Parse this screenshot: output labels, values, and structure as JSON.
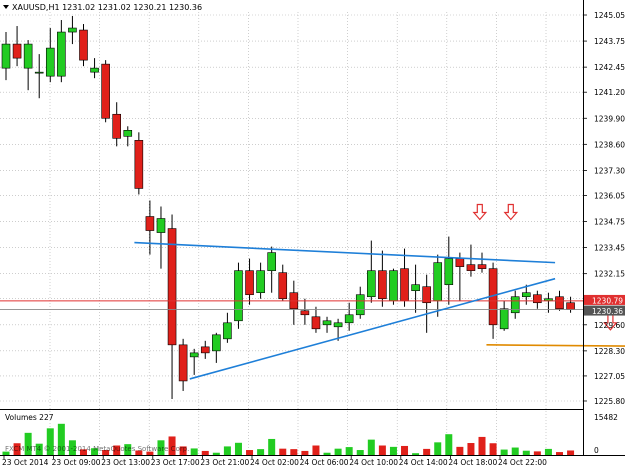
{
  "header": {
    "symbol_line": "XAUUSD,H1  1231.02 1231.02 1230.21 1230.36"
  },
  "volume_panel": {
    "title": "Volumes 227",
    "max_label": "15482",
    "min_label": "0"
  },
  "watermark": "FXCM MT4 © 2001-2014 MetaQuotes Software Corp.",
  "price_tags": {
    "ask": "1230.79",
    "bid": "1230.36"
  },
  "colors": {
    "bull": "#22cc22",
    "bear": "#e0201a",
    "trendline": "#1e7fd8",
    "support": "#e08a00",
    "ask_line": "#e03030",
    "bid_line": "#888888",
    "arrow": "#e03030"
  },
  "chart_data": {
    "type": "candlestick",
    "title": "XAUUSD,H1",
    "ylim": [
      1225.6,
      1245.2
    ],
    "y_ticks": [
      "1245.05",
      "1243.75",
      "1242.45",
      "1241.20",
      "1239.90",
      "1238.60",
      "1237.30",
      "1236.05",
      "1234.75",
      "1233.45",
      "1232.15",
      "1230.90",
      "1229.60",
      "1228.30",
      "1227.05",
      "1225.80"
    ],
    "x_ticks": [
      "23 Oct 2014",
      "23 Oct 09:00",
      "23 Oct 13:00",
      "23 Oct 17:00",
      "23 Oct 21:00",
      "24 Oct 02:00",
      "24 Oct 06:00",
      "24 Oct 10:00",
      "24 Oct 14:00",
      "24 Oct 18:00",
      "24 Oct 22:00"
    ],
    "candles": [
      {
        "o": 1242.4,
        "h": 1244.2,
        "l": 1241.8,
        "c": 1243.6
      },
      {
        "o": 1243.6,
        "h": 1244.5,
        "l": 1242.5,
        "c": 1242.9
      },
      {
        "o": 1242.4,
        "h": 1243.8,
        "l": 1241.3,
        "c": 1243.6
      },
      {
        "o": 1242.2,
        "h": 1243.1,
        "l": 1240.9,
        "c": 1242.2
      },
      {
        "o": 1242.0,
        "h": 1244.4,
        "l": 1241.7,
        "c": 1243.4
      },
      {
        "o": 1242.0,
        "h": 1244.8,
        "l": 1241.7,
        "c": 1244.2
      },
      {
        "o": 1244.2,
        "h": 1245.0,
        "l": 1243.6,
        "c": 1244.4
      },
      {
        "o": 1244.3,
        "h": 1244.6,
        "l": 1242.5,
        "c": 1242.8
      },
      {
        "o": 1242.2,
        "h": 1242.9,
        "l": 1241.9,
        "c": 1242.4
      },
      {
        "o": 1242.6,
        "h": 1242.8,
        "l": 1239.7,
        "c": 1239.9
      },
      {
        "o": 1240.1,
        "h": 1240.7,
        "l": 1238.5,
        "c": 1238.9
      },
      {
        "o": 1239.0,
        "h": 1239.5,
        "l": 1238.5,
        "c": 1239.3
      },
      {
        "o": 1238.8,
        "h": 1239.2,
        "l": 1236.1,
        "c": 1236.4
      },
      {
        "o": 1235.0,
        "h": 1235.8,
        "l": 1233.1,
        "c": 1234.3
      },
      {
        "o": 1234.2,
        "h": 1235.5,
        "l": 1232.4,
        "c": 1234.9
      },
      {
        "o": 1234.4,
        "h": 1235.1,
        "l": 1225.9,
        "c": 1228.6
      },
      {
        "o": 1228.6,
        "h": 1228.9,
        "l": 1226.3,
        "c": 1226.8
      },
      {
        "o": 1228.0,
        "h": 1228.4,
        "l": 1227.1,
        "c": 1228.2
      },
      {
        "o": 1228.5,
        "h": 1228.8,
        "l": 1227.9,
        "c": 1228.2
      },
      {
        "o": 1228.3,
        "h": 1229.2,
        "l": 1227.7,
        "c": 1229.1
      },
      {
        "o": 1228.9,
        "h": 1230.2,
        "l": 1228.7,
        "c": 1229.7
      },
      {
        "o": 1229.8,
        "h": 1232.7,
        "l": 1229.4,
        "c": 1232.3
      },
      {
        "o": 1232.3,
        "h": 1232.9,
        "l": 1230.6,
        "c": 1231.1
      },
      {
        "o": 1231.2,
        "h": 1232.7,
        "l": 1230.9,
        "c": 1232.3
      },
      {
        "o": 1232.3,
        "h": 1233.5,
        "l": 1231.2,
        "c": 1233.2
      },
      {
        "o": 1232.2,
        "h": 1232.6,
        "l": 1230.8,
        "c": 1230.9
      },
      {
        "o": 1231.2,
        "h": 1231.8,
        "l": 1229.6,
        "c": 1230.4
      },
      {
        "o": 1230.3,
        "h": 1230.9,
        "l": 1229.6,
        "c": 1230.1
      },
      {
        "o": 1230.0,
        "h": 1230.5,
        "l": 1229.2,
        "c": 1229.4
      },
      {
        "o": 1229.6,
        "h": 1230.0,
        "l": 1229.2,
        "c": 1229.8
      },
      {
        "o": 1229.5,
        "h": 1229.9,
        "l": 1228.8,
        "c": 1229.7
      },
      {
        "o": 1229.7,
        "h": 1230.7,
        "l": 1229.3,
        "c": 1230.1
      },
      {
        "o": 1230.1,
        "h": 1231.5,
        "l": 1229.9,
        "c": 1231.1
      },
      {
        "o": 1231.0,
        "h": 1233.8,
        "l": 1230.7,
        "c": 1232.3
      },
      {
        "o": 1232.3,
        "h": 1233.3,
        "l": 1230.5,
        "c": 1230.9
      },
      {
        "o": 1230.8,
        "h": 1232.4,
        "l": 1230.6,
        "c": 1232.3
      },
      {
        "o": 1232.4,
        "h": 1233.4,
        "l": 1230.5,
        "c": 1230.8
      },
      {
        "o": 1231.3,
        "h": 1232.6,
        "l": 1230.2,
        "c": 1231.6
      },
      {
        "o": 1231.5,
        "h": 1232.1,
        "l": 1229.2,
        "c": 1230.7
      },
      {
        "o": 1230.8,
        "h": 1233.1,
        "l": 1230.0,
        "c": 1232.7
      },
      {
        "o": 1231.6,
        "h": 1234.0,
        "l": 1230.6,
        "c": 1232.9
      },
      {
        "o": 1232.9,
        "h": 1233.2,
        "l": 1230.8,
        "c": 1232.5
      },
      {
        "o": 1232.6,
        "h": 1233.6,
        "l": 1232.0,
        "c": 1232.3
      },
      {
        "o": 1232.6,
        "h": 1233.2,
        "l": 1232.2,
        "c": 1232.4
      },
      {
        "o": 1232.4,
        "h": 1232.7,
        "l": 1228.9,
        "c": 1229.6
      },
      {
        "o": 1229.4,
        "h": 1230.8,
        "l": 1229.3,
        "c": 1230.4
      },
      {
        "o": 1230.2,
        "h": 1231.3,
        "l": 1229.9,
        "c": 1231.0
      },
      {
        "o": 1231.0,
        "h": 1231.6,
        "l": 1230.6,
        "c": 1231.2
      },
      {
        "o": 1231.1,
        "h": 1231.3,
        "l": 1230.4,
        "c": 1230.7
      },
      {
        "o": 1230.8,
        "h": 1231.2,
        "l": 1230.2,
        "c": 1230.9
      },
      {
        "o": 1231.0,
        "h": 1231.3,
        "l": 1230.3,
        "c": 1230.4
      },
      {
        "o": 1230.7,
        "h": 1231.0,
        "l": 1230.2,
        "c": 1230.36
      }
    ],
    "volumes": [
      1500,
      5200,
      9800,
      5000,
      11800,
      13800,
      6500,
      2500,
      3000,
      2200,
      4200,
      4800,
      2000,
      1500,
      6500,
      8200,
      3800,
      2900,
      1800,
      1000,
      3800,
      5400,
      2200,
      2600,
      7100,
      2800,
      2600,
      1800,
      4200,
      1000,
      2800,
      3500,
      2200,
      6800,
      4200,
      3600,
      4000,
      800,
      2700,
      5600,
      9200,
      3600,
      5300,
      8000,
      5200,
      2400,
      3300,
      1900,
      1600,
      2700,
      1300,
      2000
    ],
    "volume_ylim": [
      0,
      15482
    ],
    "trendlines": [
      {
        "name": "upper-trendline",
        "from": [
          11.6,
          1233.7
        ],
        "to": [
          49.6,
          1232.7
        ]
      },
      {
        "name": "lower-trendline",
        "from": [
          16.6,
          1226.9
        ],
        "to": [
          49.6,
          1231.9
        ]
      }
    ],
    "support_line": {
      "from": [
        43.4,
        1228.6
      ],
      "to": [
        63.5,
        1228.5
      ]
    },
    "down_arrows": [
      {
        "index": 42.8,
        "price": 1235.2
      },
      {
        "index": 45.6,
        "price": 1235.2
      },
      {
        "index": 54.6,
        "price": 1229.7
      }
    ],
    "grid": true,
    "legend": "none"
  }
}
